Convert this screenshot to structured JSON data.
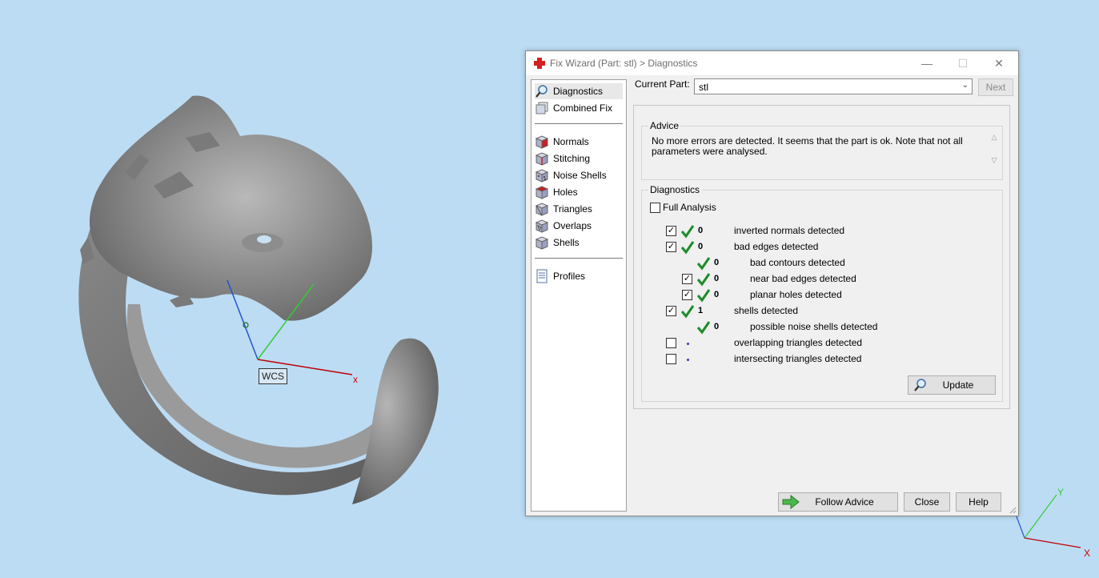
{
  "viewport": {
    "wcs_label": "WCS",
    "axis_x_label": "x",
    "corner_axes": {
      "x_label": "X",
      "y_label": "Y"
    }
  },
  "window": {
    "title": "Fix Wizard (Part: stl) > Diagnostics",
    "controls": {
      "minimize": "—",
      "maximize": "☐",
      "close": "✕"
    }
  },
  "nav": {
    "items": [
      {
        "label": "Diagnostics",
        "icon": "magnifier-icon",
        "selected": true
      },
      {
        "label": "Combined Fix",
        "icon": "combined-fix-icon"
      },
      {
        "label": "Normals",
        "icon": "normals-cube-icon"
      },
      {
        "label": "Stitching",
        "icon": "stitching-cube-icon"
      },
      {
        "label": "Noise Shells",
        "icon": "noise-shells-cube-icon"
      },
      {
        "label": "Holes",
        "icon": "holes-cube-icon"
      },
      {
        "label": "Triangles",
        "icon": "triangles-cube-icon"
      },
      {
        "label": "Overlaps",
        "icon": "overlaps-cube-icon"
      },
      {
        "label": "Shells",
        "icon": "shells-cube-icon"
      },
      {
        "label": "Profiles",
        "icon": "profiles-document-icon"
      }
    ]
  },
  "current_part": {
    "label": "Current Part:",
    "value": "stl"
  },
  "next_button": "Next",
  "advice": {
    "title": "Advice",
    "text": "No more errors are detected. It seems that the part is ok. Note that not all parameters were analysed."
  },
  "diagnostics": {
    "title": "Diagnostics",
    "full_analysis_label": "Full Analysis",
    "full_analysis_checked": false,
    "rows": [
      {
        "checkbox": true,
        "checked": true,
        "status": "ok",
        "count": "0",
        "label": "inverted normals detected",
        "indent": 0
      },
      {
        "checkbox": true,
        "checked": true,
        "status": "ok",
        "count": "0",
        "label": "bad edges detected",
        "indent": 0
      },
      {
        "checkbox": false,
        "checked": false,
        "status": "ok",
        "count": "0",
        "label": "bad contours detected",
        "indent": 1
      },
      {
        "checkbox": true,
        "checked": true,
        "status": "ok",
        "count": "0",
        "label": "near bad edges detected",
        "indent": 1
      },
      {
        "checkbox": true,
        "checked": true,
        "status": "ok",
        "count": "0",
        "label": "planar holes detected",
        "indent": 1
      },
      {
        "checkbox": true,
        "checked": true,
        "status": "ok",
        "count": "1",
        "label": "shells detected",
        "indent": 0
      },
      {
        "checkbox": false,
        "checked": false,
        "status": "ok",
        "count": "0",
        "label": "possible noise shells detected",
        "indent": 1
      },
      {
        "checkbox": true,
        "checked": false,
        "status": "not-analysed",
        "count": "",
        "label": "overlapping triangles detected",
        "indent": 0
      },
      {
        "checkbox": true,
        "checked": false,
        "status": "not-analysed",
        "count": "",
        "label": "intersecting triangles detected",
        "indent": 0
      }
    ],
    "update_button": "Update"
  },
  "footer": {
    "follow_advice": "Follow Advice",
    "close": "Close",
    "help": "Help"
  },
  "colors": {
    "background": "#bcdcf4",
    "check_green": "#1e8a2a",
    "axis_x": "#c00000",
    "axis_y": "#33cc33",
    "axis_z": "#2255cc"
  }
}
